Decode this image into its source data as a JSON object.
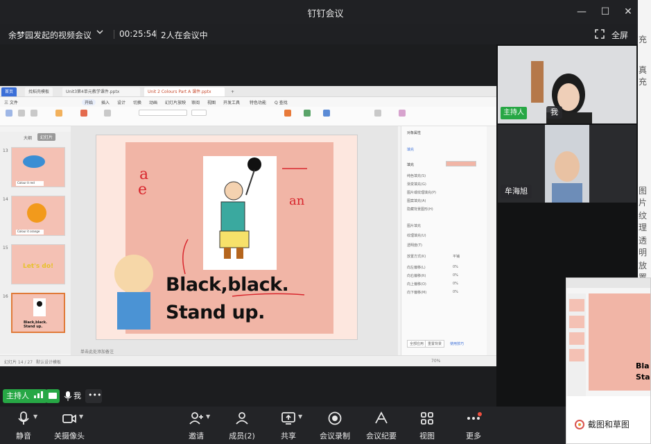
{
  "window": {
    "title": "钉钉会议",
    "min_glyph": "—",
    "max_glyph": "☐",
    "close_glyph": "✕"
  },
  "meeting": {
    "title": "余梦园发起的视频会议",
    "duration": "00:25:54",
    "participants_status": "2人在会议中",
    "fullscreen_label": "全屏"
  },
  "wps": {
    "tabs": [
      "首页",
      "找稻壳模板",
      "Unit3第4单元教学课件.pptx",
      "Unit 2 Colours Part A 课件.pptx",
      "+"
    ],
    "menu": [
      "三 文件",
      "开始",
      "插入",
      "设计",
      "切换",
      "动画",
      "幻灯片放映",
      "审阅",
      "视图",
      "开发工具",
      "特色功能",
      "Q 查找"
    ],
    "left_tabs": [
      "大纲",
      "幻灯片"
    ],
    "thumb_numbers": [
      "13",
      "14",
      "15",
      "16"
    ],
    "thumb_captions": [
      "Colour it red",
      "Colour it orange",
      "Let's do!",
      "Black,black. Stand up."
    ],
    "slide_text_1": "Black,black.",
    "slide_text_2": "Stand up.",
    "slide_letters": [
      "a",
      "e",
      "an"
    ],
    "right_panel": {
      "title": "对象属性",
      "tab": "填充",
      "section": "填充",
      "options": [
        "纯色填充(S)",
        "渐变填充(G)",
        "图片或纹理填充(P)",
        "图案填充(A)",
        "隐藏背景图形(H)"
      ],
      "fields": [
        "图片填充",
        "纹理填充(U)",
        "透明度(T)",
        "放置方式(K)",
        "向左偏移(L)",
        "向右偏移(R)",
        "向上偏移(O)",
        "向下偏移(M)"
      ],
      "placement_value": "平铺",
      "pct": "0%",
      "apply_all": "全部应用",
      "reset": "重置背景",
      "more": "使用技巧"
    },
    "status": [
      "幻灯片 14 / 27",
      "默认设计模板"
    ],
    "notes_placeholder": "单击此处添加备注",
    "zoom": "70%"
  },
  "participants": [
    {
      "name": "我",
      "host_label": "主持人"
    },
    {
      "name": "牟海旭"
    }
  ],
  "self_bar": {
    "host_label": "主持人",
    "me_label": "我",
    "more_glyph": "•••"
  },
  "toolbar": [
    {
      "id": "mute",
      "label": "静音"
    },
    {
      "id": "camera",
      "label": "关摄像头"
    },
    {
      "id": "invite",
      "label": "邀请"
    },
    {
      "id": "members",
      "label": "成员(2)"
    },
    {
      "id": "share",
      "label": "共享"
    },
    {
      "id": "record",
      "label": "会议录制"
    },
    {
      "id": "minutes",
      "label": "会议纪要"
    },
    {
      "id": "view",
      "label": "视图"
    },
    {
      "id": "more",
      "label": "更多"
    }
  ],
  "screenshot_tool": {
    "label": "截图和草图"
  },
  "desktop_edge_text": [
    "充",
    "真充",
    "图片",
    "纹理",
    "透明",
    "放置"
  ],
  "colors": {
    "host_green": "#27a745",
    "toolbar_bg": "#232427",
    "accent_red": "#f04f3f"
  }
}
